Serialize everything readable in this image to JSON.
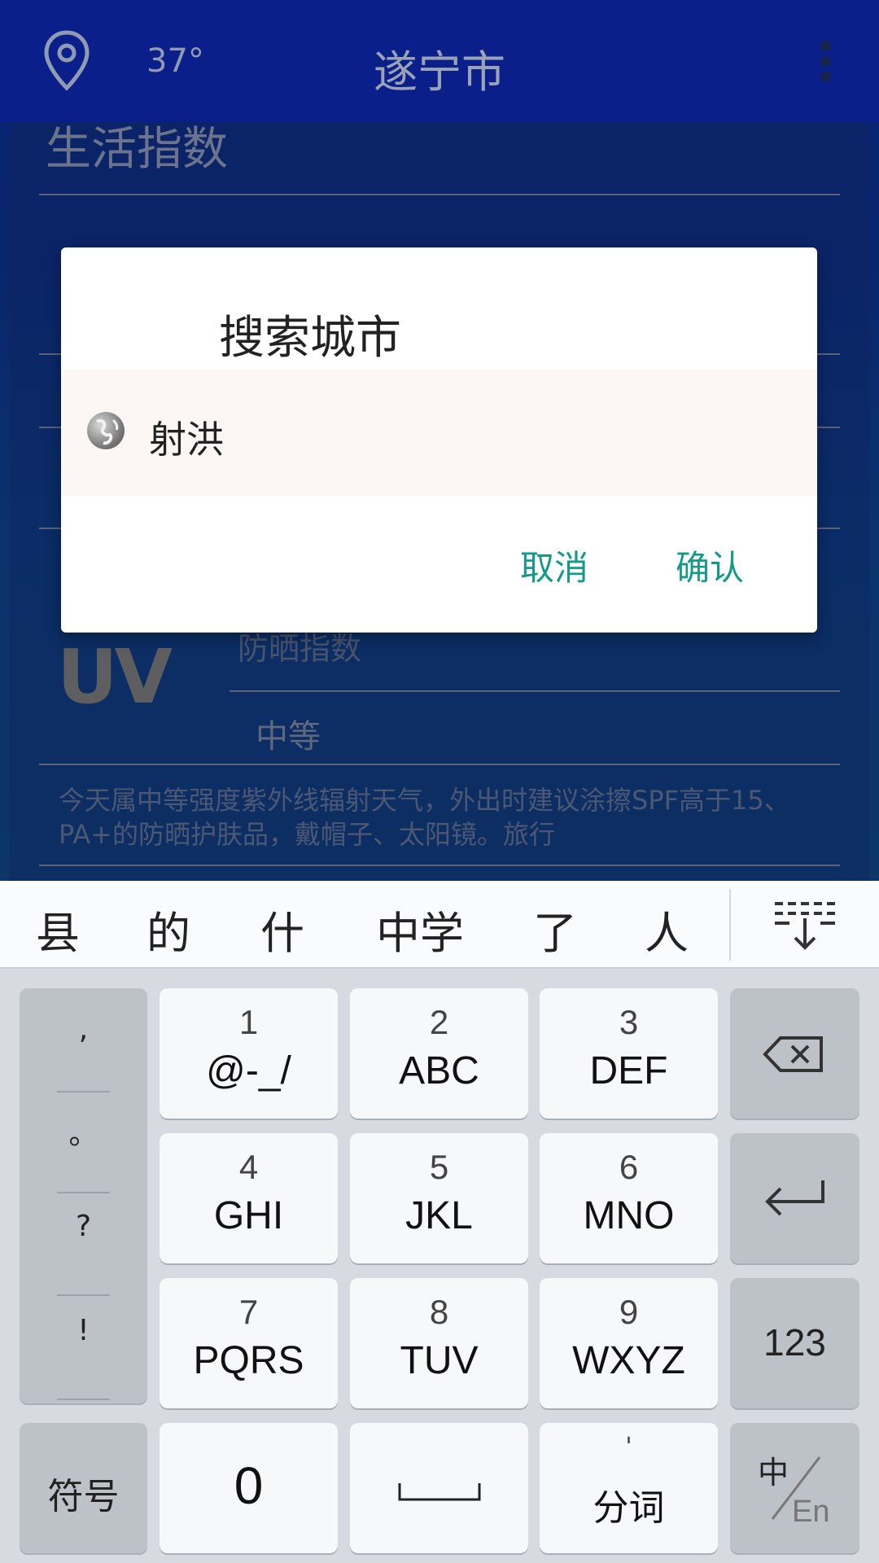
{
  "app": {
    "temperature": "37°",
    "city": "遂宁市",
    "section_title": "生活指数",
    "uv": {
      "logo": "UV",
      "label": "防晒指数",
      "level": "中等",
      "description": "今天属中等强度紫外线辐射天气，外出时建议涂擦SPF高于15、PA+的防晒护肤品，戴帽子、太阳镜。旅行"
    }
  },
  "dialog": {
    "title": "搜索城市",
    "input_value": "射洪",
    "cancel_label": "取消",
    "confirm_label": "确认"
  },
  "keyboard": {
    "candidates": [
      "县",
      "的",
      "什",
      "中学",
      "了",
      "人"
    ],
    "punctuation": [
      ",",
      "。",
      "?",
      "!"
    ],
    "keys": [
      {
        "num": "1",
        "letters": "@-_/"
      },
      {
        "num": "2",
        "letters": "ABC"
      },
      {
        "num": "3",
        "letters": "DEF"
      },
      {
        "num": "4",
        "letters": "GHI"
      },
      {
        "num": "5",
        "letters": "JKL"
      },
      {
        "num": "6",
        "letters": "MNO"
      },
      {
        "num": "7",
        "letters": "PQRS"
      },
      {
        "num": "8",
        "letters": "TUV"
      },
      {
        "num": "9",
        "letters": "WXYZ"
      }
    ],
    "numeric_label": "123",
    "symbols_label": "符号",
    "zero_label": "0",
    "split_mark": "'",
    "split_label": "分词",
    "lang_zh": "中",
    "lang_en": "En"
  },
  "icons": {
    "location": "location-pin-icon",
    "more": "more-vert-icon",
    "globe": "globe-icon",
    "collapse": "keyboard-collapse-icon",
    "backspace": "backspace-icon",
    "enter": "enter-icon",
    "space": "space-bar-icon"
  }
}
